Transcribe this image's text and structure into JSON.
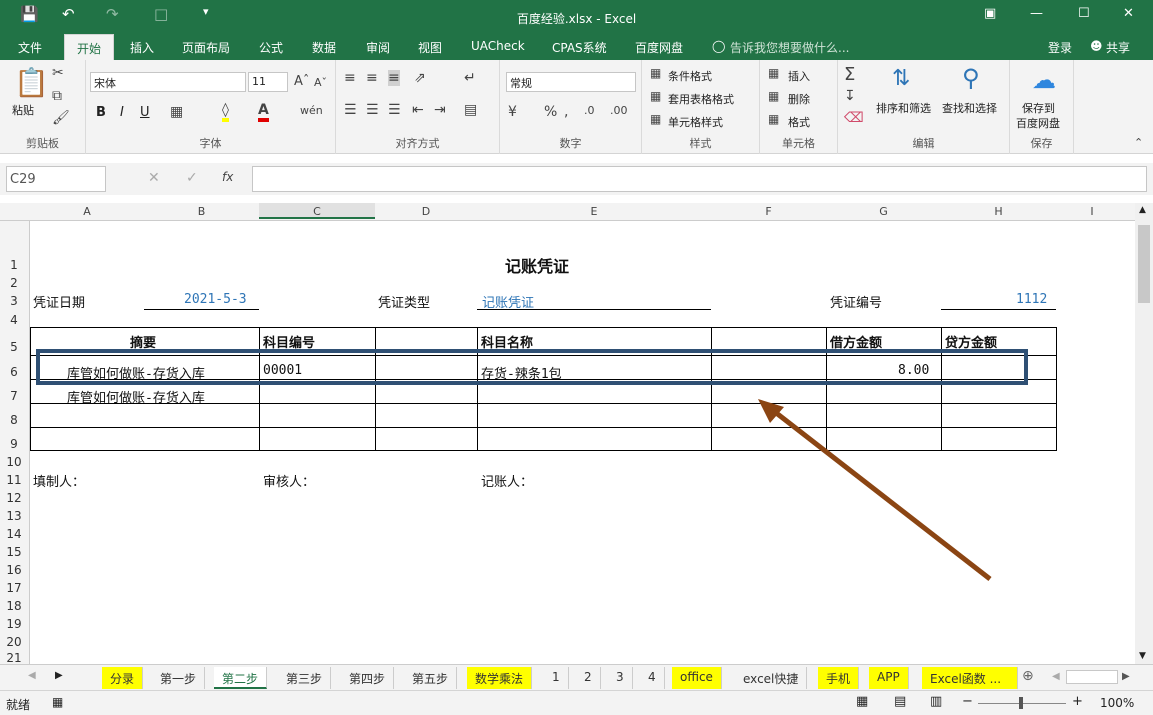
{
  "window": {
    "title": "百度经验.xlsx - Excel"
  },
  "menu": {
    "tabs": [
      "文件",
      "开始",
      "插入",
      "页面布局",
      "公式",
      "数据",
      "审阅",
      "视图",
      "UACheck",
      "CPAS系统",
      "百度网盘"
    ],
    "tellme": "告诉我您想要做什么...",
    "login": "登录",
    "share": "共享"
  },
  "ribbon": {
    "clipboard": {
      "paste": "粘贴",
      "label": "剪贴板"
    },
    "font": {
      "name": "宋体",
      "size": "11",
      "label": "字体",
      "bold": "B",
      "italic": "I",
      "underline": "U"
    },
    "align": {
      "label": "对齐方式"
    },
    "number": {
      "format": "常规",
      "label": "数字"
    },
    "styles": {
      "cond": "条件格式",
      "table": "套用表格格式",
      "cell": "单元格样式",
      "label": "样式"
    },
    "cells": {
      "insert": "插入",
      "delete": "删除",
      "format": "格式",
      "label": "单元格"
    },
    "edit": {
      "sort": "排序和筛选",
      "find": "查找和选择",
      "label": "编辑"
    },
    "save": {
      "line1": "保存到",
      "line2": "百度网盘",
      "label": "保存"
    }
  },
  "formula": {
    "namebox": "C29",
    "fx": "fx",
    "value": ""
  },
  "columns": [
    "A",
    "B",
    "C",
    "D",
    "E",
    "F",
    "G",
    "H",
    "I"
  ],
  "rows": [
    "1",
    "2",
    "3",
    "4",
    "5",
    "6",
    "7",
    "8",
    "9",
    "10",
    "11",
    "12",
    "13",
    "14",
    "15",
    "16",
    "17",
    "18",
    "19",
    "20",
    "21"
  ],
  "sheet": {
    "title": "记账凭证",
    "date_label": "凭证日期",
    "date_value": "2021-5-3",
    "type_label": "凭证类型",
    "type_value": "记账凭证",
    "num_label": "凭证编号",
    "num_value": "1112",
    "headers": {
      "summary": "摘要",
      "code": "科目编号",
      "name": "科目名称",
      "debit": "借方金额",
      "credit": "贷方金额"
    },
    "row6": {
      "summary": "库管如何做账-存货入库",
      "code": "00001",
      "name": "存货-辣条1包",
      "debit": "8.00"
    },
    "row7": {
      "summary": "库管如何做账-存货入库"
    },
    "footer": {
      "maker": "填制人：",
      "reviewer": "审核人：",
      "bookkeeper": "记账人："
    }
  },
  "sheet_tabs": [
    {
      "label": "分录",
      "yellow": true
    },
    {
      "label": "第一步",
      "yellow": false
    },
    {
      "label": "第二步",
      "active": true
    },
    {
      "label": "第三步",
      "yellow": false
    },
    {
      "label": "第四步",
      "yellow": false
    },
    {
      "label": "第五步",
      "yellow": false
    },
    {
      "label": "数学乘法",
      "yellow": true
    },
    {
      "label": "1",
      "yellow": false
    },
    {
      "label": "2",
      "yellow": false
    },
    {
      "label": "3",
      "yellow": false
    },
    {
      "label": "4",
      "yellow": false
    },
    {
      "label": "office",
      "yellow": true
    },
    {
      "label": "excel快捷",
      "yellow": false
    },
    {
      "label": "手机",
      "yellow": true
    },
    {
      "label": "APP",
      "yellow": true
    },
    {
      "label": "Excel函数 ...",
      "yellow": true
    }
  ],
  "status": {
    "ready": "就绪",
    "zoom": "100%"
  },
  "colors": {
    "excel_green": "#217346",
    "highlight_box": "#2f5074",
    "arrow": "#8b4513",
    "tab_yellow": "#ffff00"
  }
}
